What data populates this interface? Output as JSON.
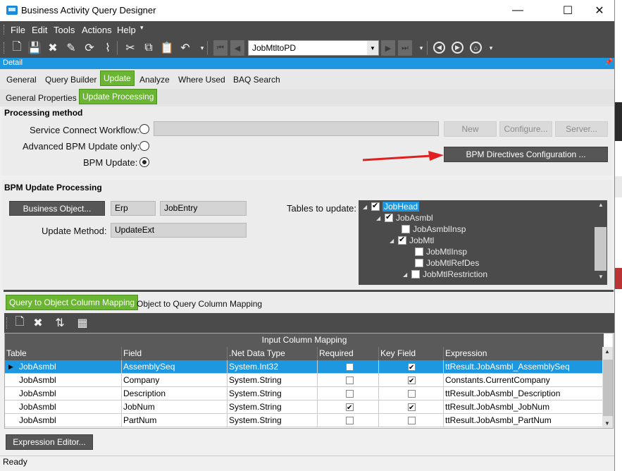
{
  "window": {
    "title": "Business Activity Query Designer",
    "minimize": "—",
    "maximize": "☐",
    "close": "✕"
  },
  "menu": [
    "File",
    "Edit",
    "Tools",
    "Actions",
    "Help"
  ],
  "toolbar": {
    "record_value": "JobMtltoPD"
  },
  "detail_header": "Detail",
  "main_tabs": [
    "General",
    "Query Builder",
    "Update",
    "Analyze",
    "Where Used",
    "BAQ Search"
  ],
  "sub_tabs": [
    "General Properties",
    "Update Processing"
  ],
  "processing": {
    "section_title": "Processing method",
    "service_connect_label": "Service Connect Workflow:",
    "advanced_bpm_label": "Advanced BPM Update only:",
    "bpm_update_label": "BPM Update:",
    "new_button": "New",
    "configure_button": "Configure...",
    "server_button": "Server...",
    "bpm_directives_button": "BPM Directives Configuration ..."
  },
  "bpm_update": {
    "section_title": "BPM Update Processing",
    "business_object_button": "Business Object...",
    "bo_prefix": "Erp",
    "bo_name": "JobEntry",
    "update_method_label": "Update Method:",
    "update_method_value": "UpdateExt",
    "tables_label": "Tables to update:"
  },
  "tree": [
    {
      "label": "JobHead",
      "checked": true,
      "level": 0,
      "expander": "◢",
      "selected": true
    },
    {
      "label": "JobAsmbl",
      "checked": true,
      "level": 1,
      "expander": "◢"
    },
    {
      "label": "JobAsmblInsp",
      "checked": false,
      "level": 2,
      "expander": ""
    },
    {
      "label": "JobMtl",
      "checked": true,
      "level": 2,
      "expander": "◢"
    },
    {
      "label": "JobMtlInsp",
      "checked": false,
      "level": 3,
      "expander": ""
    },
    {
      "label": "JobMtlRefDes",
      "checked": false,
      "level": 3,
      "expander": ""
    },
    {
      "label": "JobMtlRestriction",
      "checked": false,
      "level": 3,
      "expander": "◢"
    }
  ],
  "mapping_tabs": [
    "Query to Object Column Mapping",
    "Object to Query Column Mapping"
  ],
  "grid": {
    "caption": "Input Column Mapping",
    "columns": [
      "Table",
      "Field",
      ".Net Data Type",
      "Required",
      "Key Field",
      "Expression"
    ],
    "rows": [
      {
        "table": "JobAsmbl",
        "field": "AssemblySeq",
        "type": "System.Int32",
        "required": false,
        "key": true,
        "expression": "ttResult.JobAsmbl_AssemblySeq",
        "selected": true
      },
      {
        "table": "JobAsmbl",
        "field": "Company",
        "type": "System.String",
        "required": false,
        "key": true,
        "expression": "Constants.CurrentCompany"
      },
      {
        "table": "JobAsmbl",
        "field": "Description",
        "type": "System.String",
        "required": false,
        "key": false,
        "expression": "ttResult.JobAsmbl_Description"
      },
      {
        "table": "JobAsmbl",
        "field": "JobNum",
        "type": "System.String",
        "required": true,
        "key": true,
        "expression": "ttResult.JobAsmbl_JobNum"
      },
      {
        "table": "JobAsmbl",
        "field": "PartNum",
        "type": "System.String",
        "required": false,
        "key": false,
        "expression": "ttResult.JobAsmbl_PartNum"
      }
    ]
  },
  "expression_editor_button": "Expression Editor...",
  "status": "Ready",
  "colors": {
    "accent_blue": "#1c97e0",
    "tab_green": "#6ab531",
    "dark_bar": "#4b4b4b",
    "arrow_red": "#e02020"
  },
  "icons": [
    "app-icon",
    "new-icon",
    "save-icon",
    "delete-icon",
    "clear-icon",
    "refresh-icon",
    "brush-icon",
    "cut-icon",
    "copy-icon",
    "paste-icon",
    "undo-icon",
    "first-icon",
    "prev-icon",
    "next-icon",
    "last-icon",
    "back-icon",
    "forward-icon",
    "home-icon",
    "pin-icon",
    "mouse-cursor-icon",
    "red-arrow-icon",
    "sort-icon",
    "grid-settings-icon"
  ]
}
